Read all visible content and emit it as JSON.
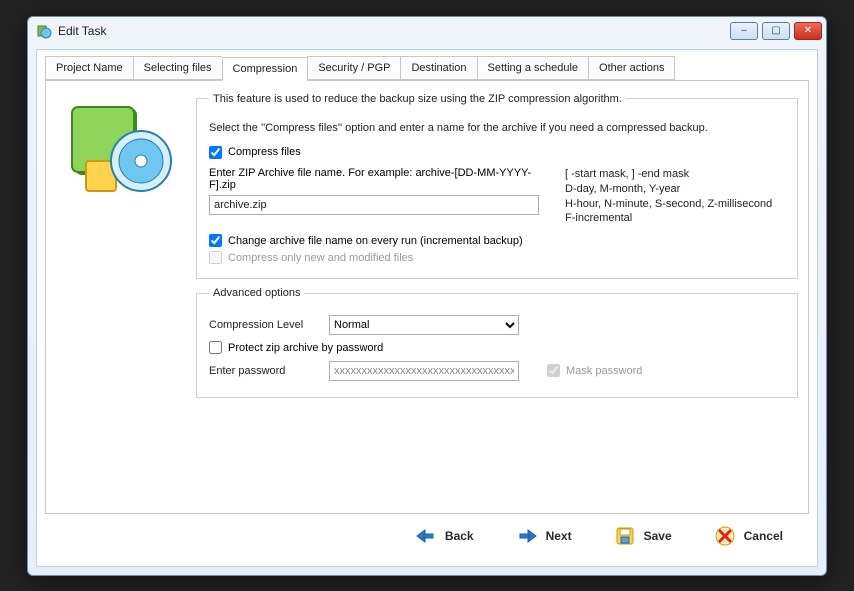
{
  "window": {
    "title": "Edit Task"
  },
  "tabs": {
    "items": [
      {
        "label": "Project Name"
      },
      {
        "label": "Selecting files"
      },
      {
        "label": "Compression"
      },
      {
        "label": "Security / PGP"
      },
      {
        "label": "Destination"
      },
      {
        "label": "Setting a schedule"
      },
      {
        "label": "Other actions"
      }
    ],
    "activeIndex": 2
  },
  "compression": {
    "legend": "This feature is used to reduce the backup size using the ZIP compression algorithm.",
    "hint": "Select the ''Compress files'' option and enter a name for the archive if you need a compressed backup.",
    "compressFiles": {
      "label": "Compress files",
      "checked": true
    },
    "enterNameLabel": "Enter ZIP Archive file name.  For example:   archive-[DD-MM-YYYY-F].zip",
    "archiveName": "archive.zip",
    "maskLegend1": "[ -start mask, ] -end mask",
    "maskLegend2": "D-day, M-month, Y-year",
    "maskLegend3": "H-hour, N-minute, S-second,  Z-millisecond",
    "maskLegend4": "F-incremental",
    "incremental": {
      "label": "Change archive file name on every run (incremental backup)",
      "checked": true
    },
    "onlyNew": {
      "label": "Compress only new and modified files",
      "checked": false
    }
  },
  "advanced": {
    "legend": "Advanced options",
    "levelLabel": "Compression Level",
    "levelValue": "Normal",
    "protect": {
      "label": "Protect zip archive by password",
      "checked": false
    },
    "pwdLabel": "Enter password",
    "pwdValue": "xxxxxxxxxxxxxxxxxxxxxxxxxxxxxxxxxxxxxxxxxxxxxx",
    "mask": {
      "label": "Mask password",
      "checked": true
    }
  },
  "buttons": {
    "back": "Back",
    "next": "Next",
    "save": "Save",
    "cancel": "Cancel"
  }
}
